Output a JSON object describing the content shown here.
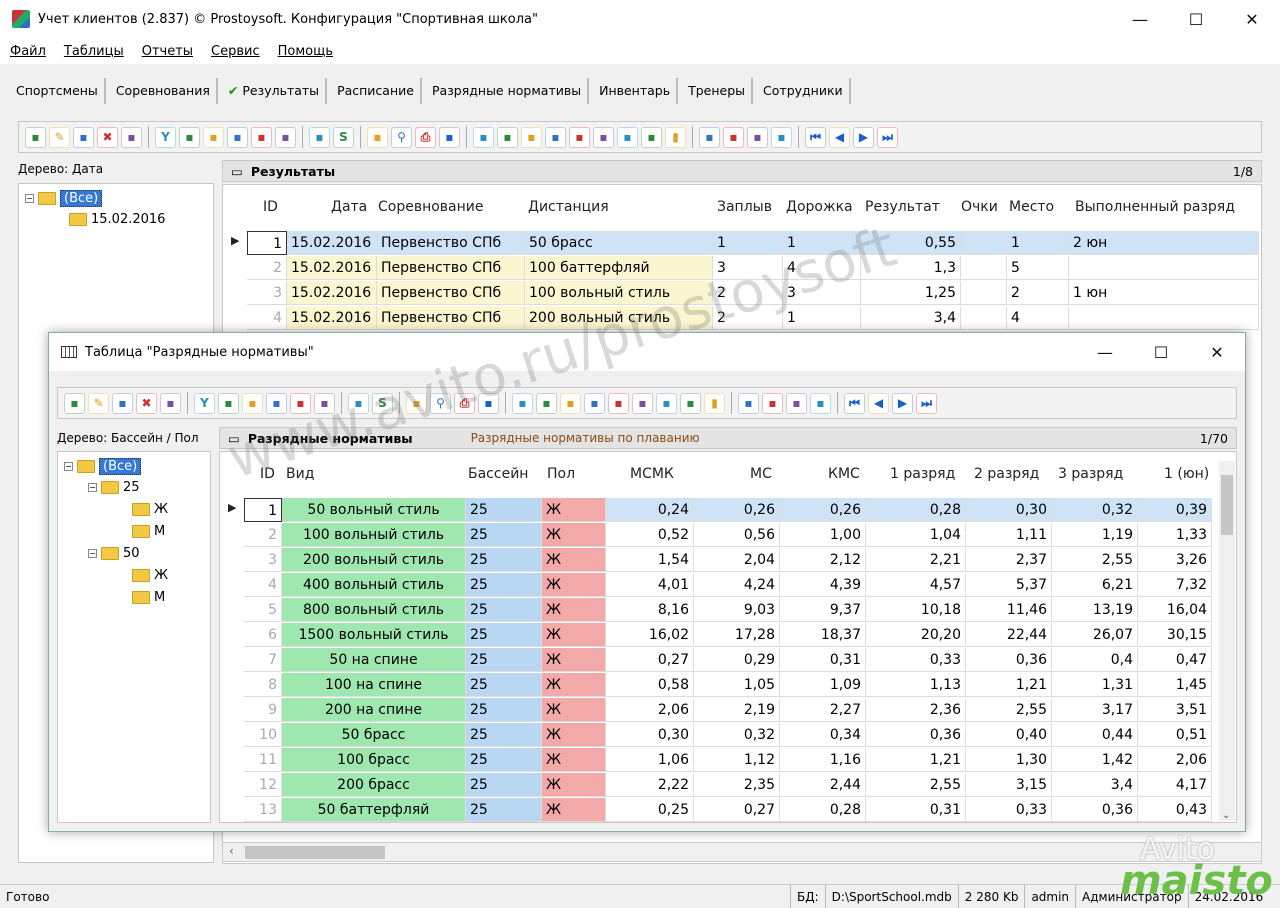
{
  "window": {
    "title": "Учет клиентов (2.837) © Prostoysoft. Конфигурация \"Спортивная школа\"",
    "minimize": "—",
    "maximize": "☐",
    "close": "✕"
  },
  "menu": [
    "Файл",
    "Таблицы",
    "Отчеты",
    "Сервис",
    "Помощь"
  ],
  "tabs": [
    {
      "label": "Спортсмены"
    },
    {
      "label": "Соревнования"
    },
    {
      "label": "Результаты",
      "active": true,
      "mark": "✔"
    },
    {
      "label": "Расписание"
    },
    {
      "label": "Разрядные нормативы"
    },
    {
      "label": "Инвентарь"
    },
    {
      "label": "Тренеры"
    },
    {
      "label": "Сотрудники"
    }
  ],
  "toolbar_icons": [
    "import-icon",
    "edit-icon",
    "copy-icon",
    "delete-icon",
    "table-icon",
    "filter-icon",
    "filter-add-icon",
    "filter-remove-icon",
    "filter-clear-icon",
    "filter-settings-icon",
    "filter-alt-icon",
    "tree-filter-icon",
    "sql-icon",
    "refresh-icon",
    "find-icon",
    "print-icon",
    "preview-icon",
    "export-icon",
    "export2-icon",
    "word-icon",
    "excel-icon",
    "excel2-icon",
    "html-icon",
    "xml-icon",
    "csv-icon",
    "chart-icon",
    "doc-icon",
    "doc2-icon",
    "grid-icon",
    "grid2-icon",
    "first-icon",
    "prev-icon",
    "next-icon",
    "last-icon"
  ],
  "main": {
    "tree_label": "Дерево: Дата",
    "tree": {
      "root": "(Все)",
      "child": "15.02.2016"
    },
    "panel_title": "Результаты",
    "record_counter": "1/8",
    "columns": [
      "ID",
      "Дата",
      "Соревнование",
      "Дистанция",
      "Заплыв",
      "Дорожка",
      "Результат",
      "Очки",
      "Место",
      "Выполненный разряд"
    ],
    "rows": [
      [
        "1",
        "15.02.2016",
        "Первенство СПб",
        "50 брасс",
        "1",
        "1",
        "0,55",
        "",
        "1",
        "2 юн"
      ],
      [
        "2",
        "15.02.2016",
        "Первенство СПб",
        "100 баттерфляй",
        "3",
        "4",
        "1,3",
        "",
        "5",
        ""
      ],
      [
        "3",
        "15.02.2016",
        "Первенство СПб",
        "100 вольный стиль",
        "2",
        "3",
        "1,25",
        "",
        "2",
        "1 юн"
      ],
      [
        "4",
        "15.02.2016",
        "Первенство СПб",
        "200 вольный стиль",
        "2",
        "1",
        "3,4",
        "",
        "4",
        ""
      ]
    ]
  },
  "norms_window": {
    "title": "Таблица \"Разрядные нормативы\"",
    "tree_label": "Дерево: Бассейн / Пол",
    "tree": {
      "root": "(Все)",
      "pool1": "25",
      "pool2": "50",
      "g1": "Ж",
      "g2": "М"
    },
    "panel_title": "Разрядные нормативы",
    "panel_subtitle": "Разрядные нормативы по плаванию",
    "record_counter": "1/70",
    "columns": [
      "ID",
      "Вид",
      "Бассейн",
      "Пол",
      "МСМК",
      "МС",
      "КМС",
      "1 разряд",
      "2 разряд",
      "3 разряд",
      "1 (юн)"
    ],
    "rows": [
      [
        "1",
        "50 вольный стиль",
        "25",
        "Ж",
        "0,24",
        "0,26",
        "0,26",
        "0,28",
        "0,30",
        "0,32",
        "0,39"
      ],
      [
        "2",
        "100 вольный стиль",
        "25",
        "Ж",
        "0,52",
        "0,56",
        "1,00",
        "1,04",
        "1,11",
        "1,19",
        "1,33"
      ],
      [
        "3",
        "200 вольный стиль",
        "25",
        "Ж",
        "1,54",
        "2,04",
        "2,12",
        "2,21",
        "2,37",
        "2,55",
        "3,26"
      ],
      [
        "4",
        "400 вольный стиль",
        "25",
        "Ж",
        "4,01",
        "4,24",
        "4,39",
        "4,57",
        "5,37",
        "6,21",
        "7,32"
      ],
      [
        "5",
        "800 вольный стиль",
        "25",
        "Ж",
        "8,16",
        "9,03",
        "9,37",
        "10,18",
        "11,46",
        "13,19",
        "16,04"
      ],
      [
        "6",
        "1500 вольный стиль",
        "25",
        "Ж",
        "16,02",
        "17,28",
        "18,37",
        "20,20",
        "22,44",
        "26,07",
        "30,15"
      ],
      [
        "7",
        "50 на спине",
        "25",
        "Ж",
        "0,27",
        "0,29",
        "0,31",
        "0,33",
        "0,36",
        "0,4",
        "0,47"
      ],
      [
        "8",
        "100 на спине",
        "25",
        "Ж",
        "0,58",
        "1,05",
        "1,09",
        "1,13",
        "1,21",
        "1,31",
        "1,45"
      ],
      [
        "9",
        "200 на спине",
        "25",
        "Ж",
        "2,06",
        "2,19",
        "2,27",
        "2,36",
        "2,55",
        "3,17",
        "3,51"
      ],
      [
        "10",
        "50 брасс",
        "25",
        "Ж",
        "0,30",
        "0,32",
        "0,34",
        "0,36",
        "0,40",
        "0,44",
        "0,51"
      ],
      [
        "11",
        "100 брасс",
        "25",
        "Ж",
        "1,06",
        "1,12",
        "1,16",
        "1,21",
        "1,30",
        "1,42",
        "2,06"
      ],
      [
        "12",
        "200 брасс",
        "25",
        "Ж",
        "2,22",
        "2,35",
        "2,44",
        "2,55",
        "3,15",
        "3,4",
        "4,17"
      ],
      [
        "13",
        "50 баттерфляй",
        "25",
        "Ж",
        "0,25",
        "0,27",
        "0,28",
        "0,31",
        "0,33",
        "0,36",
        "0,43"
      ]
    ]
  },
  "status": {
    "ready": "Готово",
    "db_label": "БД:",
    "db_path": "D:\\SportSchool.mdb",
    "size": "2 280 Kb",
    "user": "admin",
    "role": "Администратор",
    "date": "24.02.2016"
  },
  "watermark": {
    "text": "www.avito.ru/prostoysoft",
    "avito": "Avito",
    "maisto": "maisto"
  },
  "colors": {
    "selection": "#cfe3f7",
    "type_col": "#9ee8b0",
    "pool_col": "#b9d7f2",
    "gender_col": "#f4a9a9",
    "date_col": "#fbf6cf"
  }
}
